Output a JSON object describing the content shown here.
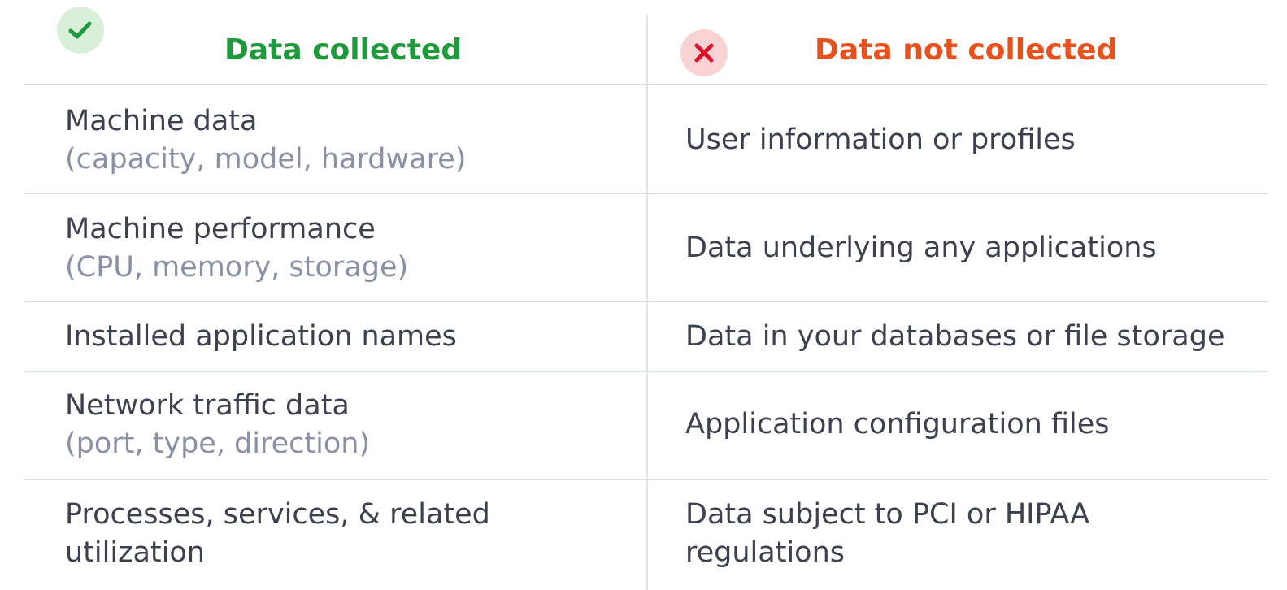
{
  "headers": {
    "collected": "Data collected",
    "not_collected": "Data not collected",
    "collected_icon": "check-icon",
    "not_collected_icon": "close-icon"
  },
  "colors": {
    "collected": "#1e9a3a",
    "not_collected": "#e8501c",
    "collected_badge_bg": "#d8efd9",
    "not_collected_badge_bg": "#f9d3d3",
    "text": "#3c4150",
    "subtext": "#8a90a6",
    "grid": "#d9dee8"
  },
  "rows": [
    {
      "collected": "Machine data",
      "collected_detail": "(capacity, model, hardware)",
      "not_collected": "User information or profiles"
    },
    {
      "collected": "Machine performance",
      "collected_detail": "(CPU, memory, storage)",
      "not_collected": "Data underlying any applications"
    },
    {
      "collected": "Installed application names",
      "not_collected": "Data in your databases or file storage"
    },
    {
      "collected": "Network traffic data",
      "collected_detail": "(port, type, direction)",
      "not_collected": "Application configuration files"
    },
    {
      "collected": "Processes, services, & related",
      "collected_line2": "utilization",
      "not_collected": "Data subject to PCI or HIPAA",
      "not_collected_line2": "regulations"
    }
  ]
}
